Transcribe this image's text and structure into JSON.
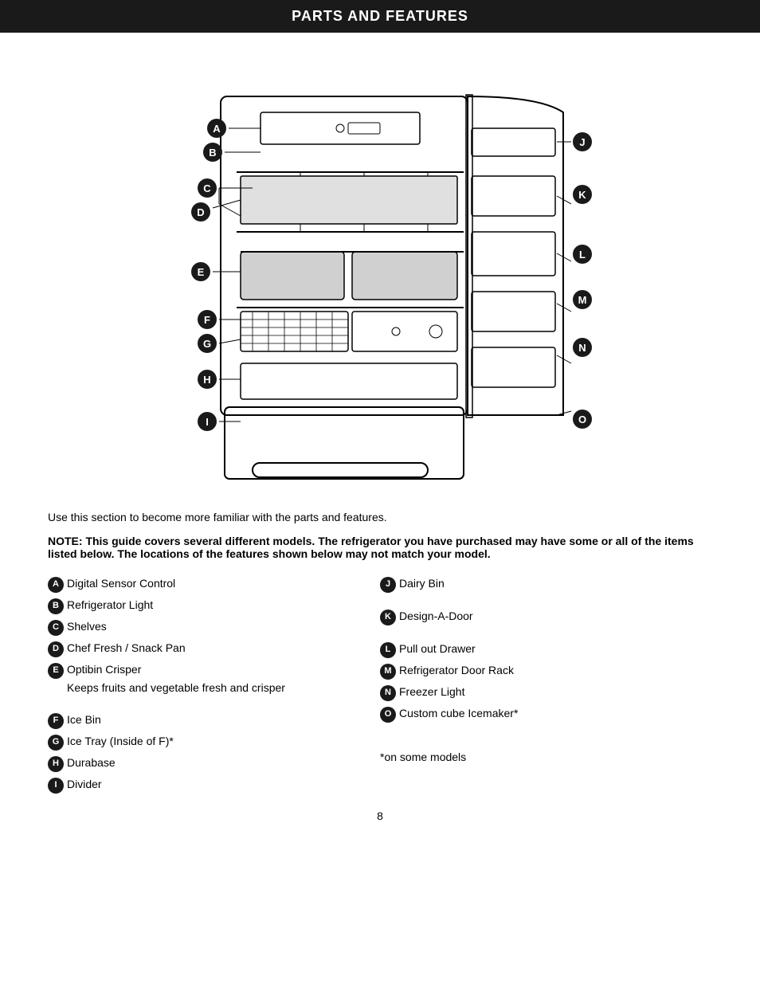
{
  "header": {
    "title": "PARTS AND FEATURES"
  },
  "intro": "Use this section to become more familiar with the parts and features.",
  "note": "NOTE: This guide covers several different models. The refrigerator you have purchased may have some or all of the items listed below. The locations of the features shown below may not match your model.",
  "features_left": [
    {
      "badge": "A",
      "label": "Digital Sensor Control",
      "sub": null
    },
    {
      "badge": "B",
      "label": "Refrigerator Light",
      "sub": null
    },
    {
      "badge": "C",
      "label": "Shelves",
      "sub": null
    },
    {
      "badge": "D",
      "label": "Chef Fresh / Snack Pan",
      "sub": null
    },
    {
      "badge": "E",
      "label": "Optibin Crisper",
      "sub": "Keeps fruits and vegetable fresh and crisper"
    },
    {
      "badge": "F",
      "label": "Ice Bin",
      "sub": null
    },
    {
      "badge": "G",
      "label": "Ice Tray (Inside of F)*",
      "sub": null
    },
    {
      "badge": "H",
      "label": "Durabase",
      "sub": null
    },
    {
      "badge": "I",
      "label": "Divider",
      "sub": null
    }
  ],
  "features_right": [
    {
      "badge": "J",
      "label": "Dairy Bin"
    },
    {
      "badge": "K",
      "label": "Design-A-Door"
    },
    {
      "badge": "L",
      "label": "Pull out Drawer"
    },
    {
      "badge": "M",
      "label": "Refrigerator Door Rack"
    },
    {
      "badge": "N",
      "label": "Freezer Light"
    },
    {
      "badge": "O",
      "label": "Custom cube Icemaker*"
    }
  ],
  "on_models": "*on some models",
  "page_number": "8"
}
